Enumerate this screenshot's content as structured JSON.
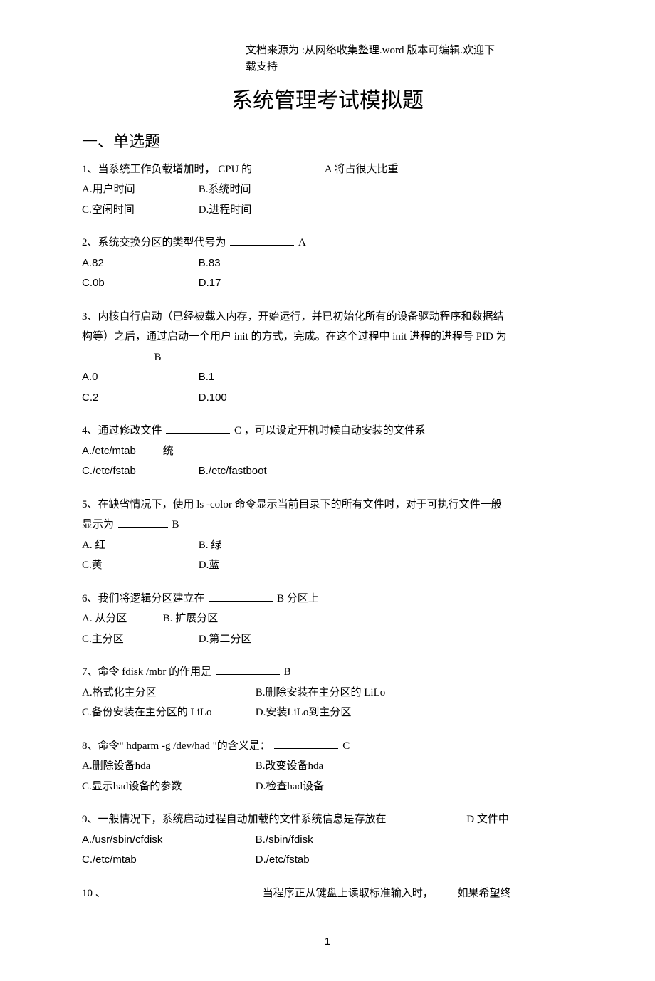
{
  "source_note": "文档来源为 :从网络收集整理.word 版本可编辑.欢迎下载支持",
  "title": "系统管理考试模拟题",
  "section1": "一、单选题",
  "q1": {
    "stem_a": "1、当系统工作负载增加时， CPU 的",
    "stem_b": "A 将占很大比重",
    "optA": "A.用户时间",
    "optB": "B.系统时间",
    "optC": "C.空闲时间",
    "optD": "D.进程时间"
  },
  "q2": {
    "stem_a": "2、系统交换分区的类型代号为",
    "stem_b": "A",
    "optA": "A.82",
    "optB": "B.83",
    "optC": "C.0b",
    "optD": "D.17"
  },
  "q3": {
    "line1": "3、内核自行启动（已经被载入内存，开始运行，并已初始化所有的设备驱动程序和数据结",
    "line2": "构等）之后，通过启动一个用户 init 的方式，完成。在这个过程中  init 进程的进程号 PID 为",
    "ans": "B",
    "optA": "A.0",
    "optB": "B.1",
    "optC": "C.2",
    "optD": "D.100"
  },
  "q4": {
    "stem_a": "4、通过修改文件",
    "stem_b": "C ，可以设定开机时候自动安装的文件系",
    "optA": "A./etc/mtab",
    "suffix": "统",
    "optB": "B./etc/fastboot",
    "optC": "C./etc/fstab"
  },
  "q5": {
    "line1": "5、在缺省情况下，使用  ls -color 命令显示当前目录下的所有文件时，对于可执行文件一般",
    "line2a": "显示为",
    "ans": "B",
    "optA": "A. 红",
    "optB": "B. 绿",
    "optC": "C.黄",
    "optD": "D.蓝"
  },
  "q6": {
    "stem_a": "6、我们将逻辑分区建立在",
    "stem_b": "B 分区上",
    "optA": "A. 从分区",
    "optB": "B. 扩展分区",
    "optC": "C.主分区",
    "optD": "D.第二分区"
  },
  "q7": {
    "stem_a": "7、命令 fdisk /mbr 的作用是",
    "stem_b": "B",
    "optA": "A.格式化主分区",
    "optB": "B.删除安装在主分区的  LiLo",
    "optC": "C.备份安装在主分区的 LiLo",
    "optD": "D.安装LiLo到主分区"
  },
  "q8": {
    "stem_a": "8、命令\" hdparm -g /dev/had \"的含义是：",
    "stem_b": "C",
    "optA": "A.删除设备hda",
    "optB": "B.改变设备hda",
    "optC": "C.显示had设备的参数",
    "optD": "D.检查had设备"
  },
  "q9": {
    "stem_a": "9、一般情况下，系统启动过程自动加载的文件系统信息是存放在",
    "stem_b": "D 文件中",
    "optA": "A./usr/sbin/cfdisk",
    "optB": "B./sbin/fdisk",
    "optC": "C./etc/mtab",
    "optD": "D./etc/fstab"
  },
  "q10": {
    "num": "10 、",
    "text_a": "当程序正从键盘上读取标准输入时，",
    "text_b": "如果希望终"
  },
  "page_number": "1"
}
